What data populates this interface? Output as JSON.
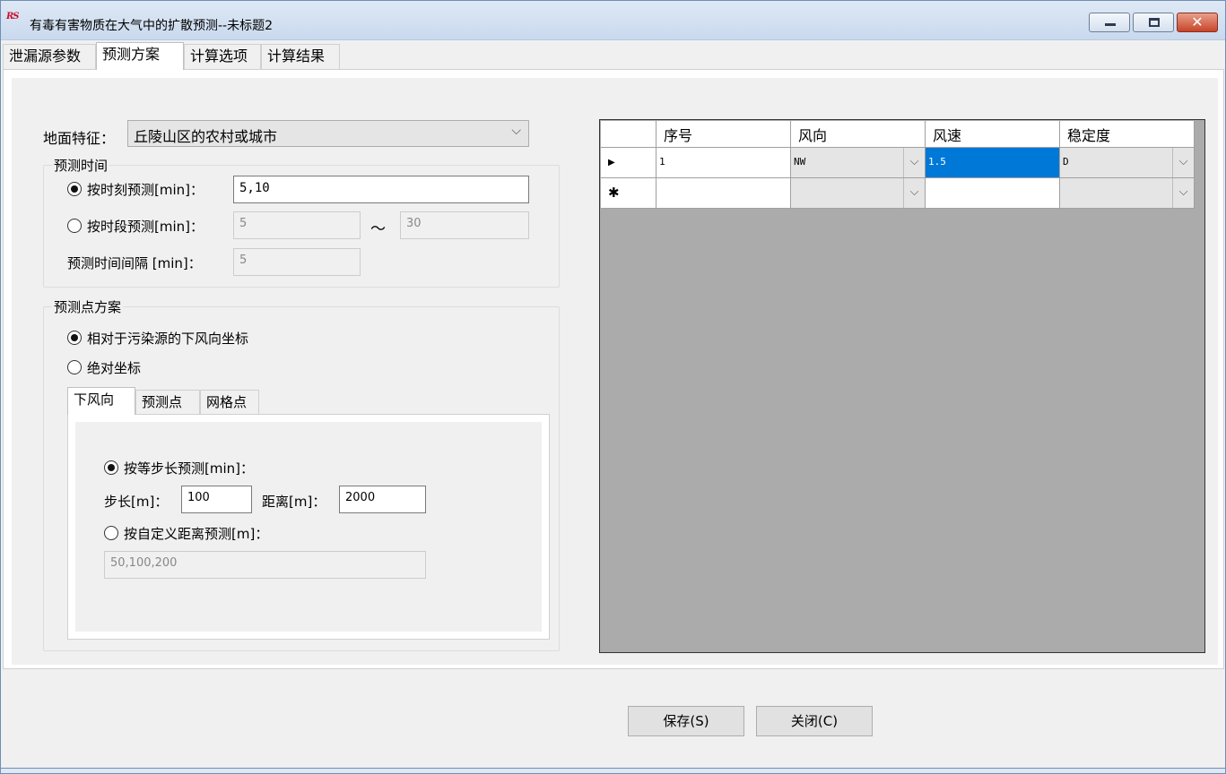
{
  "window": {
    "app_icon": "RS",
    "title": "有毒有害物质在大气中的扩散预测--未标题2",
    "controls": {
      "minimize": "minimize-icon",
      "maximize": "maximize-icon",
      "close": "close-icon",
      "close_glyph": "✕"
    }
  },
  "tabs": [
    {
      "label": "泄漏源参数",
      "active": false
    },
    {
      "label": "预测方案",
      "active": true
    },
    {
      "label": "计算选项",
      "active": false
    },
    {
      "label": "计算结果",
      "active": false
    }
  ],
  "terrain": {
    "label": "地面特征：",
    "value": "丘陵山区的农村或城市",
    "chevron": "⌵"
  },
  "time_group": {
    "title": "预测时间",
    "by_moment": {
      "label": "按时刻预测[min]：",
      "value": "5,10",
      "selected": true
    },
    "by_period": {
      "label": "按时段预测[min]：",
      "from": "5",
      "tilde": "～",
      "to": "30",
      "selected": false
    },
    "interval": {
      "label": "预测时间间隔 [min]：",
      "value": "5"
    }
  },
  "point_group": {
    "title": "预测点方案",
    "relative": {
      "label": "相对于污染源的下风向坐标",
      "selected": true
    },
    "absolute": {
      "label": "绝对坐标",
      "selected": false
    },
    "subtabs": [
      "下风向",
      "预测点",
      "网格点"
    ],
    "equal_step": {
      "label": "按等步长预测[min]：",
      "selected": true
    },
    "step": {
      "label": "步长[m]：",
      "value": "100"
    },
    "distance": {
      "label": "距离[m]：",
      "value": "2000"
    },
    "custom": {
      "label": "按自定义距离预测[m]：",
      "selected": false,
      "value": "50,100,200"
    }
  },
  "grid": {
    "columns": [
      "序号",
      "风向",
      "风速",
      "稳定度"
    ],
    "rows": [
      {
        "marker": "▶",
        "index": "1",
        "wind_dir": "NW",
        "wind_speed": "1.5",
        "stability": "D"
      },
      {
        "marker": "✱",
        "index": "",
        "wind_dir": "",
        "wind_speed": "",
        "stability": ""
      }
    ],
    "dropdown_glyph": "⌵"
  },
  "buttons": {
    "save": "保存(S)",
    "close": "关闭(C)"
  }
}
